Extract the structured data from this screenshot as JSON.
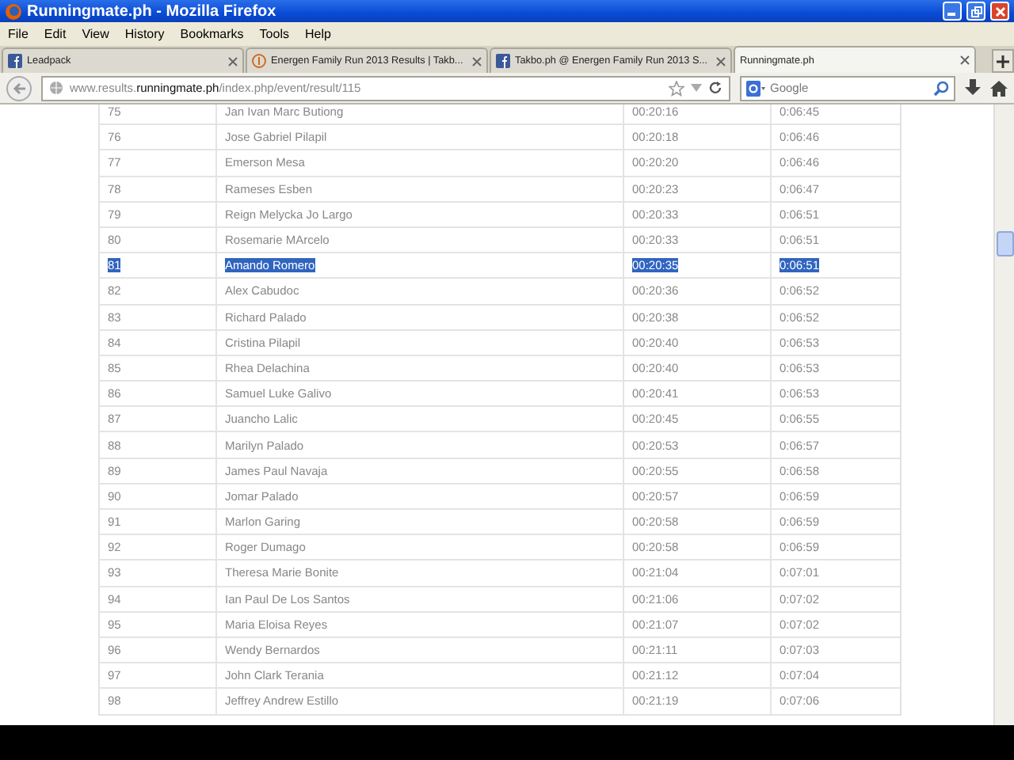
{
  "window": {
    "title": "Runningmate.ph - Mozilla Firefox"
  },
  "menu": [
    "File",
    "Edit",
    "View",
    "History",
    "Bookmarks",
    "Tools",
    "Help"
  ],
  "tabs": [
    {
      "label": "Leadpack",
      "selected": false
    },
    {
      "label": "Energen Family Run 2013 Results | Takb...",
      "selected": false
    },
    {
      "label": "Takbo.ph @ Energen Family Run 2013 S...",
      "selected": false
    },
    {
      "label": "Runningmate.ph",
      "selected": true
    }
  ],
  "address": {
    "prefix": "www.results.",
    "domain": "runningmate.ph",
    "path": "/index.php/event/result/115"
  },
  "search": {
    "placeholder": "Google"
  },
  "rows": [
    {
      "rank": "75",
      "name": "Jan Ivan Marc Butiong",
      "time": "00:20:16",
      "pace": "0:06:45",
      "selected": false
    },
    {
      "rank": "76",
      "name": "Jose Gabriel Pilapil",
      "time": "00:20:18",
      "pace": "0:06:46",
      "selected": false
    },
    {
      "rank": "77",
      "name": "Emerson Mesa",
      "time": "00:20:20",
      "pace": "0:06:46",
      "selected": false
    },
    {
      "rank": "78",
      "name": "Rameses Esben",
      "time": "00:20:23",
      "pace": "0:06:47",
      "selected": false
    },
    {
      "rank": "79",
      "name": "Reign Melycka Jo Largo",
      "time": "00:20:33",
      "pace": "0:06:51",
      "selected": false
    },
    {
      "rank": "80",
      "name": "Rosemarie MArcelo",
      "time": "00:20:33",
      "pace": "0:06:51",
      "selected": false
    },
    {
      "rank": "81",
      "name": "Amando Romero",
      "time": "00:20:35",
      "pace": "0:06:51",
      "selected": true
    },
    {
      "rank": "82",
      "name": "Alex Cabudoc",
      "time": "00:20:36",
      "pace": "0:06:52",
      "selected": false
    },
    {
      "rank": "83",
      "name": "Richard Palado",
      "time": "00:20:38",
      "pace": "0:06:52",
      "selected": false
    },
    {
      "rank": "84",
      "name": "Cristina Pilapil",
      "time": "00:20:40",
      "pace": "0:06:53",
      "selected": false
    },
    {
      "rank": "85",
      "name": "Rhea Delachina",
      "time": "00:20:40",
      "pace": "0:06:53",
      "selected": false
    },
    {
      "rank": "86",
      "name": "Samuel Luke Galivo",
      "time": "00:20:41",
      "pace": "0:06:53",
      "selected": false
    },
    {
      "rank": "87",
      "name": "Juancho Lalic",
      "time": "00:20:45",
      "pace": "0:06:55",
      "selected": false
    },
    {
      "rank": "88",
      "name": "Marilyn Palado",
      "time": "00:20:53",
      "pace": "0:06:57",
      "selected": false
    },
    {
      "rank": "89",
      "name": "James Paul Navaja",
      "time": "00:20:55",
      "pace": "0:06:58",
      "selected": false
    },
    {
      "rank": "90",
      "name": "Jomar Palado",
      "time": "00:20:57",
      "pace": "0:06:59",
      "selected": false
    },
    {
      "rank": "91",
      "name": "Marlon Garing",
      "time": "00:20:58",
      "pace": "0:06:59",
      "selected": false
    },
    {
      "rank": "92",
      "name": "Roger Dumago",
      "time": "00:20:58",
      "pace": "0:06:59",
      "selected": false
    },
    {
      "rank": "93",
      "name": "Theresa Marie Bonite",
      "time": "00:21:04",
      "pace": "0:07:01",
      "selected": false
    },
    {
      "rank": "94",
      "name": "Ian Paul De Los Santos",
      "time": "00:21:06",
      "pace": "0:07:02",
      "selected": false
    },
    {
      "rank": "95",
      "name": "Maria Eloisa Reyes",
      "time": "00:21:07",
      "pace": "0:07:02",
      "selected": false
    },
    {
      "rank": "96",
      "name": "Wendy Bernardos",
      "time": "00:21:11",
      "pace": "0:07:03",
      "selected": false
    },
    {
      "rank": "97",
      "name": "John Clark Terania",
      "time": "00:21:12",
      "pace": "0:07:04",
      "selected": false
    },
    {
      "rank": "98",
      "name": "Jeffrey Andrew Estillo",
      "time": "00:21:19",
      "pace": "0:07:06",
      "selected": false
    }
  ]
}
